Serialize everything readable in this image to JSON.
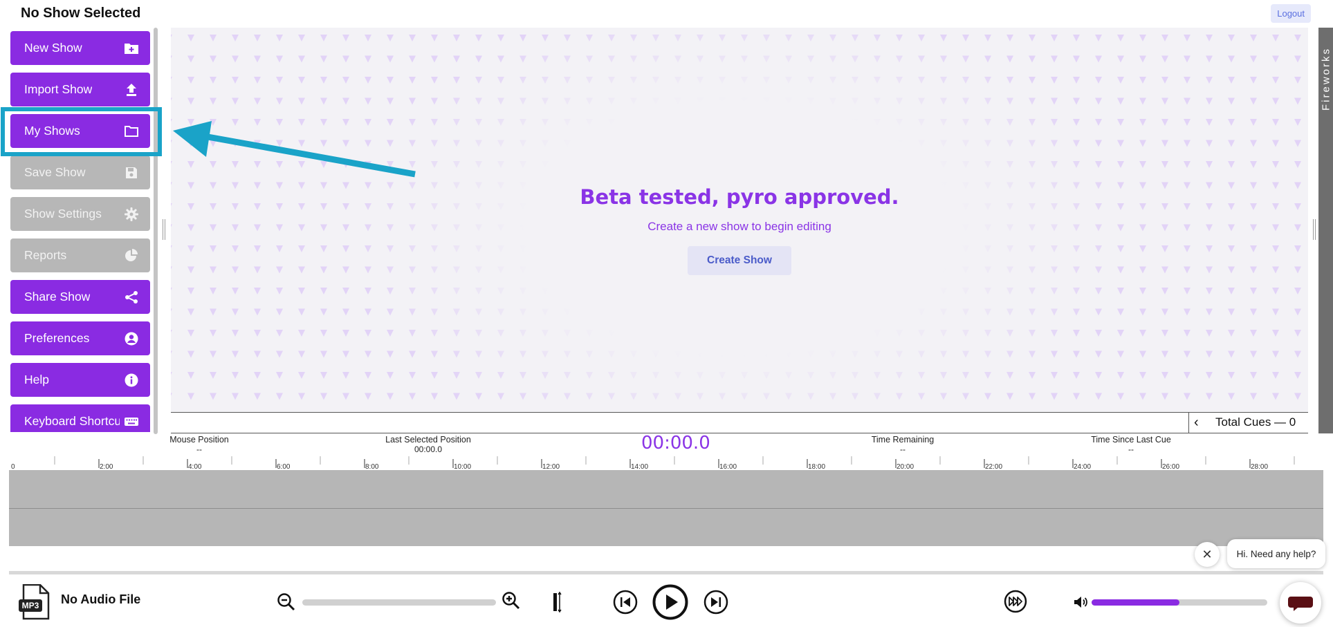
{
  "header": {
    "title": "No Show Selected",
    "logout_label": "Logout"
  },
  "sidebar": {
    "items": [
      {
        "label": "New Show",
        "icon": "folder-plus-icon",
        "enabled": true
      },
      {
        "label": "Import Show",
        "icon": "upload-icon",
        "enabled": true
      },
      {
        "label": "My Shows",
        "icon": "folder-icon",
        "enabled": true
      },
      {
        "label": "Save Show",
        "icon": "floppy-icon",
        "enabled": false
      },
      {
        "label": "Show Settings",
        "icon": "gear-icon",
        "enabled": false
      },
      {
        "label": "Reports",
        "icon": "pie-chart-icon",
        "enabled": false
      },
      {
        "label": "Share Show",
        "icon": "share-icon",
        "enabled": true
      },
      {
        "label": "Preferences",
        "icon": "user-circle-icon",
        "enabled": true
      },
      {
        "label": "Help",
        "icon": "info-icon",
        "enabled": true
      },
      {
        "label": "Keyboard Shortcuts",
        "icon": "keyboard-icon",
        "enabled": true
      }
    ]
  },
  "hero": {
    "title": "Beta tested, pyro approved.",
    "subtitle": "Create a new show to begin editing",
    "button_label": "Create Show"
  },
  "side_tab": {
    "label": "Fireworks"
  },
  "cues": {
    "label": "Total Cues — 0"
  },
  "timeline_info": {
    "mouse_position": {
      "label": "Mouse Position",
      "value": "--"
    },
    "last_selected": {
      "label": "Last Selected Position",
      "value": "00:00.0"
    },
    "current_time": "00:00.0",
    "time_remaining": {
      "label": "Time Remaining",
      "value": "--"
    },
    "since_last_cue": {
      "label": "Time Since Last Cue",
      "value": "--"
    }
  },
  "ruler": {
    "labels": [
      "0",
      "2:00",
      "4:00",
      "6:00",
      "8:00",
      "10:00",
      "12:00",
      "14:00",
      "16:00",
      "18:00",
      "20:00",
      "22:00",
      "24:00",
      "26:00",
      "28:00"
    ]
  },
  "chat": {
    "message": "Hi. Need any help?"
  },
  "player": {
    "audio_file": "No Audio File",
    "file_badge": "MP3",
    "volume_level": 0.5
  },
  "colors": {
    "accent": "#8a2be2",
    "highlight": "#1aa3c8",
    "disabled": "#b7b7b7"
  }
}
